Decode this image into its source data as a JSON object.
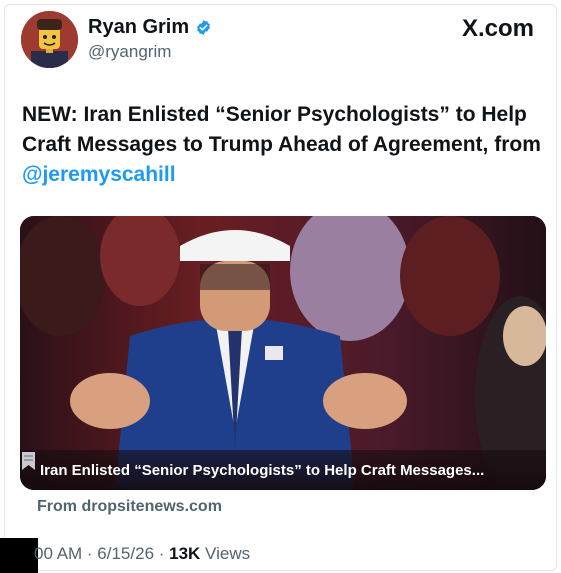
{
  "author": {
    "name": "Ryan Grim",
    "handle": "@ryangrim",
    "verified": true,
    "avatar_icon": "lego-figure-avatar"
  },
  "brand": {
    "label": "X.com"
  },
  "tweet": {
    "text_prefix": "NEW: Iran Enlisted “Senior Psychologists” to Help Craft Messages to Trump Ahead of Agreement, from ",
    "mention": "@jeremyscahill"
  },
  "link_card": {
    "image_icon": "news-photo",
    "caption": "Iran Enlisted “Senior Psychologists” to Help Craft Messages...",
    "source": "From dropsitenews.com"
  },
  "meta": {
    "time_and_date": "00 AM · 6/15/26 · ",
    "views_count": "13K",
    "views_label": " Views"
  },
  "colors": {
    "accent": "#1d9bf0",
    "text": "#0f1419",
    "secondary": "#536471"
  }
}
